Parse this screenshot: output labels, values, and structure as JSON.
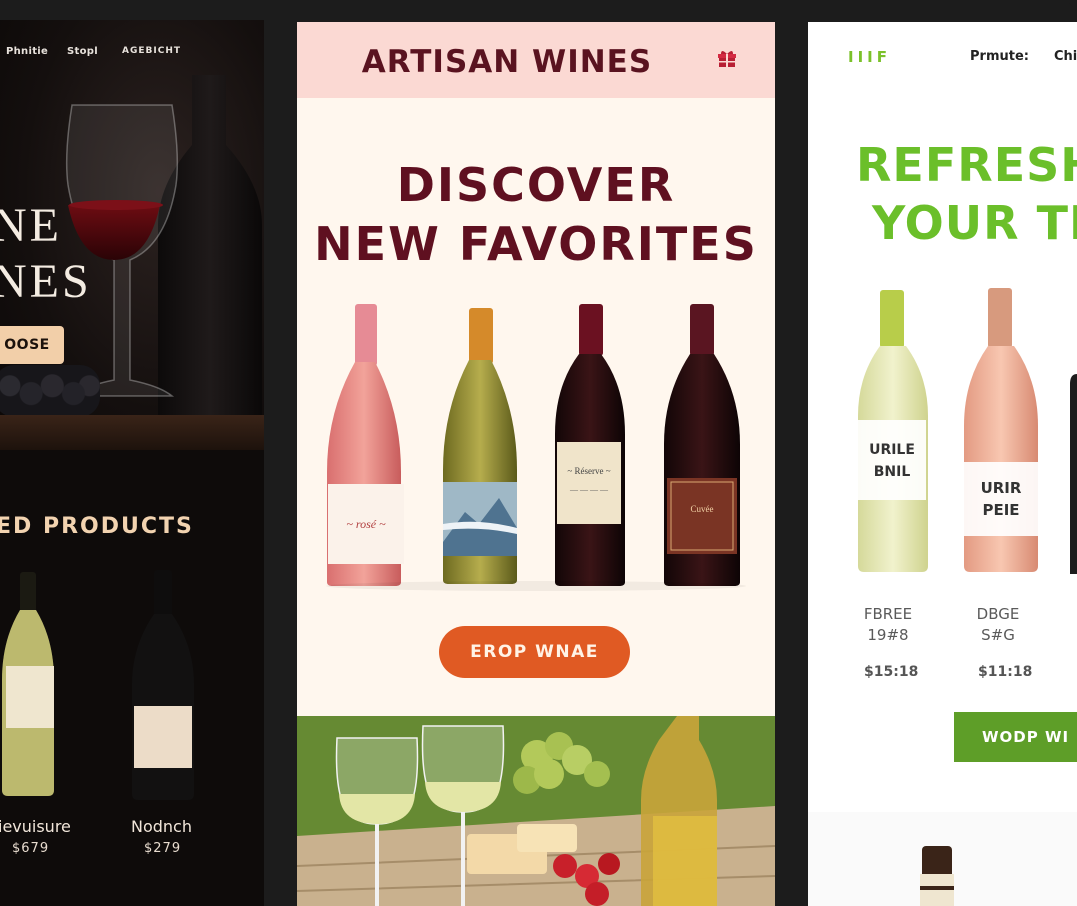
{
  "left_panel": {
    "nav": [
      "Phnitie",
      "Stopl",
      "AGEBICHT"
    ],
    "hero_title_line1": "NE",
    "hero_title_line2": "NES",
    "cta_label": "OOSE",
    "section_title": "ED PRODUCTS",
    "products": [
      {
        "name": "ievuisure",
        "price": "$679"
      },
      {
        "name": "Nodnch",
        "price": "$279"
      }
    ]
  },
  "center_panel": {
    "brand": "ARTISAN WINES",
    "header_icon": "gift-icon",
    "headline_line1": "DISCOVER",
    "headline_line2": "NEW FAVORITES",
    "cta_label": "EROP WNAE",
    "colors": {
      "header_bg": "#fbd9d3",
      "headline": "#5f1020",
      "cta": "#e05a23",
      "bg": "#fff7ee"
    }
  },
  "right_panel": {
    "logo": "IIIF",
    "nav": [
      "Prmute:",
      "Chi"
    ],
    "headline_line1": "REFRESH",
    "headline_line2": "YOUR TH",
    "bottle_labels": [
      {
        "line1": "URILE",
        "line2": "BNIL"
      },
      {
        "line1": "URIR",
        "line2": "PEIE"
      }
    ],
    "products": [
      {
        "name_line1": "FBREE",
        "name_line2": "19#8",
        "price": "$15:18"
      },
      {
        "name_line1": "DBGE",
        "name_line2": "S#G",
        "price": "$11:18"
      }
    ],
    "cta_label": "WODP WI",
    "colors": {
      "accent": "#6bbf2a",
      "cta": "#5e9e28"
    }
  }
}
